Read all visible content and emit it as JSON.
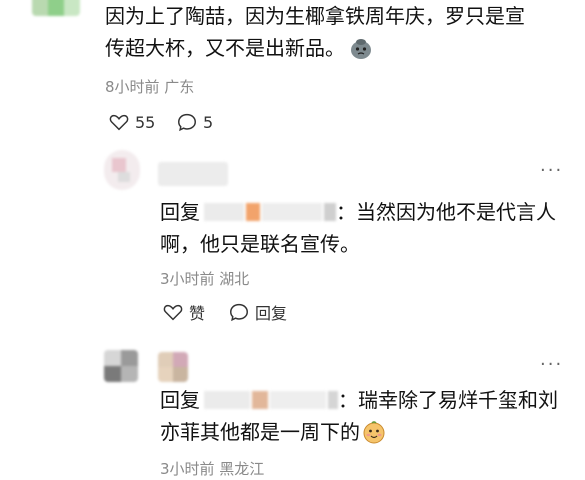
{
  "comment": {
    "text_line1": "因为上了陶喆，因为生椰拿铁周年庆，罗只是宣",
    "text_line2": "传超大杯，又不是出新品。",
    "emoji_icon": "sticker-emoji-icon",
    "meta": "8小时前 广东",
    "likes": "55",
    "replies": "5"
  },
  "replies": [
    {
      "reply_prefix": "回复",
      "text_line1": "：当然因为他不是代言人",
      "text_line2": "啊，他只是联名宣传。",
      "meta": "3小时前 湖北",
      "like_label": "赞",
      "reply_label": "回复",
      "more_label": "···"
    },
    {
      "reply_prefix": "回复",
      "text_line1": "：瑞幸除了易烊千玺和刘",
      "text_line2": "亦菲其他都是一周下的",
      "meta": "3小时前 黑龙江",
      "more_label": "···"
    }
  ],
  "colors": {
    "meta_gray": "#8a8a8a",
    "icon_gray": "#333333",
    "orange_badge": "#f2a36b"
  }
}
